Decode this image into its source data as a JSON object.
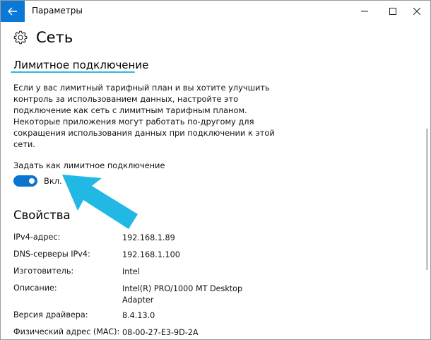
{
  "window": {
    "title": "Параметры"
  },
  "page": {
    "title": "Сеть",
    "icon": "gear-icon"
  },
  "metered": {
    "heading": "Лимитное подключение",
    "description_lines": [
      "Если у вас лимитный тарифный план и вы хотите улучшить",
      "контроль за использованием данных, настройте это",
      "подключение как сеть с лимитным тарифным планом.",
      "Некоторые приложения могут работать по-другому для",
      "сокращения использования данных при подключении к этой",
      "сети."
    ],
    "toggle_label": "Задать как лимитное подключение",
    "toggle_state": "Вкл.",
    "toggle_on": true
  },
  "properties": {
    "heading": "Свойства",
    "rows": [
      {
        "name": "IPv4-адрес:",
        "value": [
          "192.168.1.89"
        ]
      },
      {
        "name": "DNS-серверы IPv4:",
        "value": [
          "192.168.1.100"
        ]
      },
      {
        "name": "Изготовитель:",
        "value": [
          "Intel"
        ]
      },
      {
        "name": "Описание:",
        "value": [
          "Intel(R) PRO/1000 MT Desktop",
          "Adapter"
        ]
      },
      {
        "name": "Версия драйвера:",
        "value": [
          "8.4.13.0"
        ]
      },
      {
        "name": "Физический адрес (MAC):",
        "value": [
          "08-00-27-E3-9D-2A"
        ]
      }
    ]
  },
  "colors": {
    "accent": "#0a78d7",
    "underline": "#34b4e3",
    "annotation_arrow": "#22b8e4"
  }
}
